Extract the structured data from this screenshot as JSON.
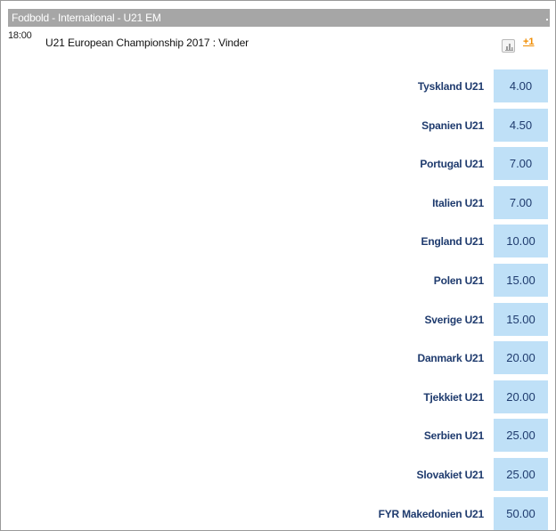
{
  "header": {
    "title": "Fodbold - International - U21 EM"
  },
  "event": {
    "time": "18:00",
    "title": "U21 European Championship 2017 : Vinder",
    "more_markets": "+1",
    "stats_icon": "bar-chart-icon"
  },
  "selections": [
    {
      "name": "Tyskland U21",
      "odds": "4.00"
    },
    {
      "name": "Spanien U21",
      "odds": "4.50"
    },
    {
      "name": "Portugal U21",
      "odds": "7.00"
    },
    {
      "name": "Italien U21",
      "odds": "7.00"
    },
    {
      "name": "England U21",
      "odds": "10.00"
    },
    {
      "name": "Polen U21",
      "odds": "15.00"
    },
    {
      "name": "Sverige U21",
      "odds": "15.00"
    },
    {
      "name": "Danmark U21",
      "odds": "20.00"
    },
    {
      "name": "Tjekkiet U21",
      "odds": "20.00"
    },
    {
      "name": "Serbien U21",
      "odds": "25.00"
    },
    {
      "name": "Slovakiet U21",
      "odds": "25.00"
    },
    {
      "name": "FYR Makedonien U21",
      "odds": "50.00"
    }
  ],
  "colors": {
    "header_bg": "#a6a6a6",
    "odds_bg": "#bfe0f7",
    "selection_text": "#1f3b6e",
    "more_link": "#f08c00"
  }
}
